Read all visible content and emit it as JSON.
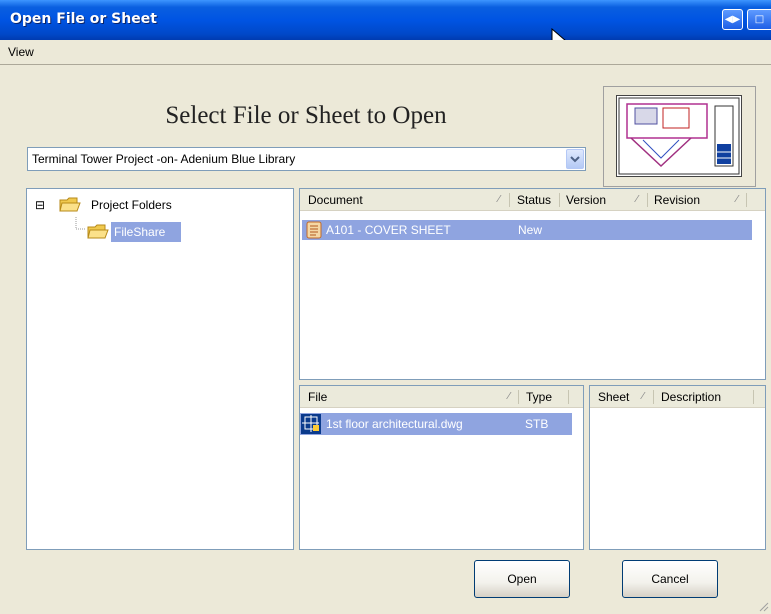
{
  "window": {
    "title": "Open File or Sheet",
    "menu": [
      "View"
    ]
  },
  "heading": "Select File or Sheet to Open",
  "library_combo": {
    "value": "Terminal Tower Project -on- Adenium Blue Library"
  },
  "tree": {
    "root_label": "Project Folders",
    "expander": "⊟",
    "child_label": "FileShare"
  },
  "documents": {
    "columns": [
      "Document",
      "Status",
      "Version",
      "Revision"
    ],
    "rows": [
      {
        "document": "A101 - COVER SHEET",
        "status": "New"
      }
    ]
  },
  "files": {
    "columns": [
      "File",
      "Type"
    ],
    "rows": [
      {
        "file": "1st floor architectural.dwg",
        "type": "STB"
      }
    ]
  },
  "sheets": {
    "columns": [
      "Sheet",
      "Description"
    ]
  },
  "buttons": {
    "open": "Open",
    "cancel": "Cancel"
  },
  "icons": {
    "title_buttons": [
      "dock-arrows-icon",
      "window-icon"
    ]
  },
  "colors": {
    "titlebar": "#0054e3",
    "selection": "#8fa4e0",
    "face": "#ece9d8"
  }
}
